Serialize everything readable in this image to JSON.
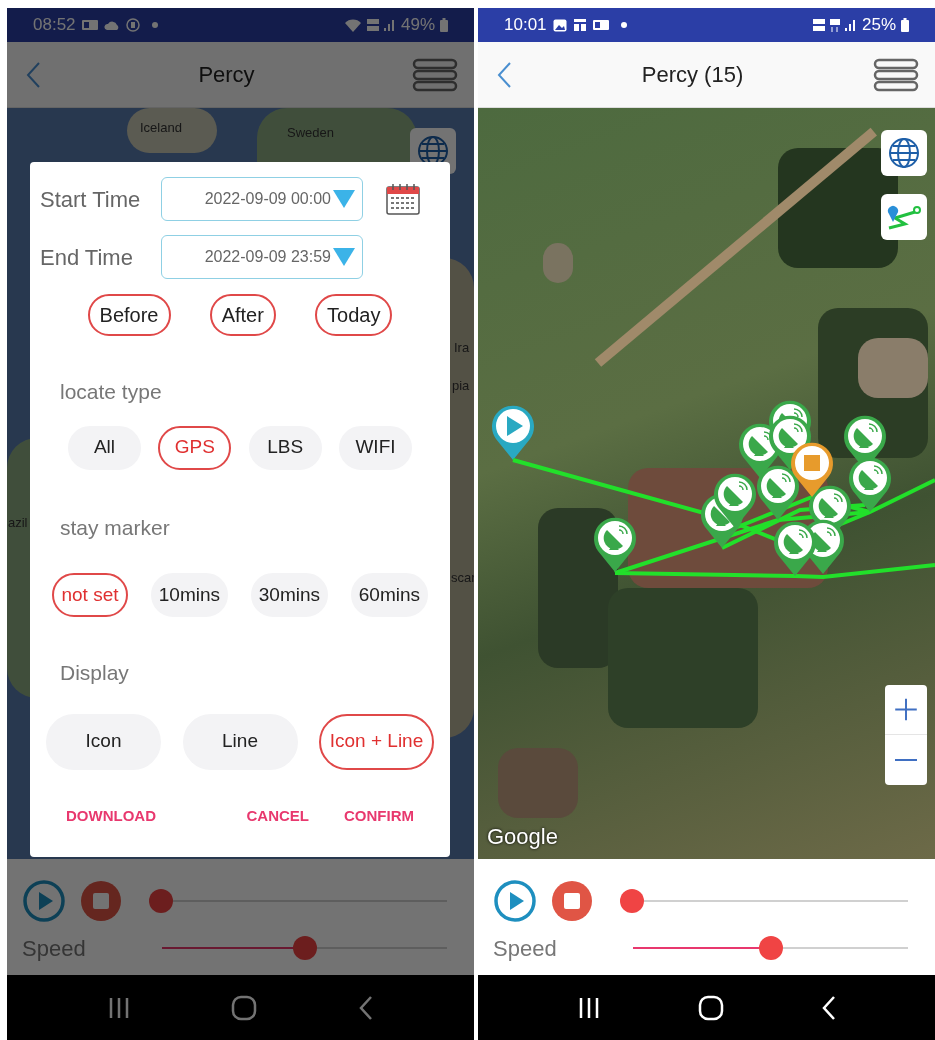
{
  "left_screen": {
    "status_bar": {
      "time": "08:52",
      "battery": "49%"
    },
    "app_bar": {
      "title": "Percy"
    },
    "map": {
      "labels": [
        "Iceland",
        "Sweden",
        "Ira",
        "pia",
        "scar",
        "azil"
      ]
    },
    "dialog": {
      "start_time": {
        "label": "Start Time",
        "value": "2022-09-09 00:00"
      },
      "end_time": {
        "label": "End Time",
        "value": "2022-09-09 23:59"
      },
      "quick_buttons": [
        "Before",
        "After",
        "Today"
      ],
      "locate_type": {
        "title": "locate type",
        "options": [
          {
            "label": "All",
            "selected": false
          },
          {
            "label": "GPS",
            "selected": true
          },
          {
            "label": "LBS",
            "selected": false
          },
          {
            "label": "WIFI",
            "selected": false
          }
        ]
      },
      "stay_marker": {
        "title": "stay marker",
        "options": [
          {
            "label": "not set",
            "selected": true
          },
          {
            "label": "10mins",
            "selected": false
          },
          {
            "label": "30mins",
            "selected": false
          },
          {
            "label": "60mins",
            "selected": false
          }
        ]
      },
      "display": {
        "title": "Display",
        "options": [
          {
            "label": "Icon",
            "selected": false
          },
          {
            "label": "Line",
            "selected": false
          },
          {
            "label": "Icon + Line",
            "selected": true
          }
        ]
      },
      "actions": [
        "DOWNLOAD",
        "CANCEL",
        "CONFIRM"
      ]
    },
    "playback": {
      "progress": {
        "level": 0
      },
      "speed": {
        "label": "Speed",
        "level": 0.5
      }
    }
  },
  "right_screen": {
    "status_bar": {
      "time": "10:01",
      "battery": "25%"
    },
    "app_bar": {
      "title": "Percy (15)"
    },
    "map": {
      "attribution": "Google"
    },
    "playback": {
      "progress": {
        "level": 0
      },
      "speed": {
        "label": "Speed",
        "level": 0.5
      }
    }
  }
}
